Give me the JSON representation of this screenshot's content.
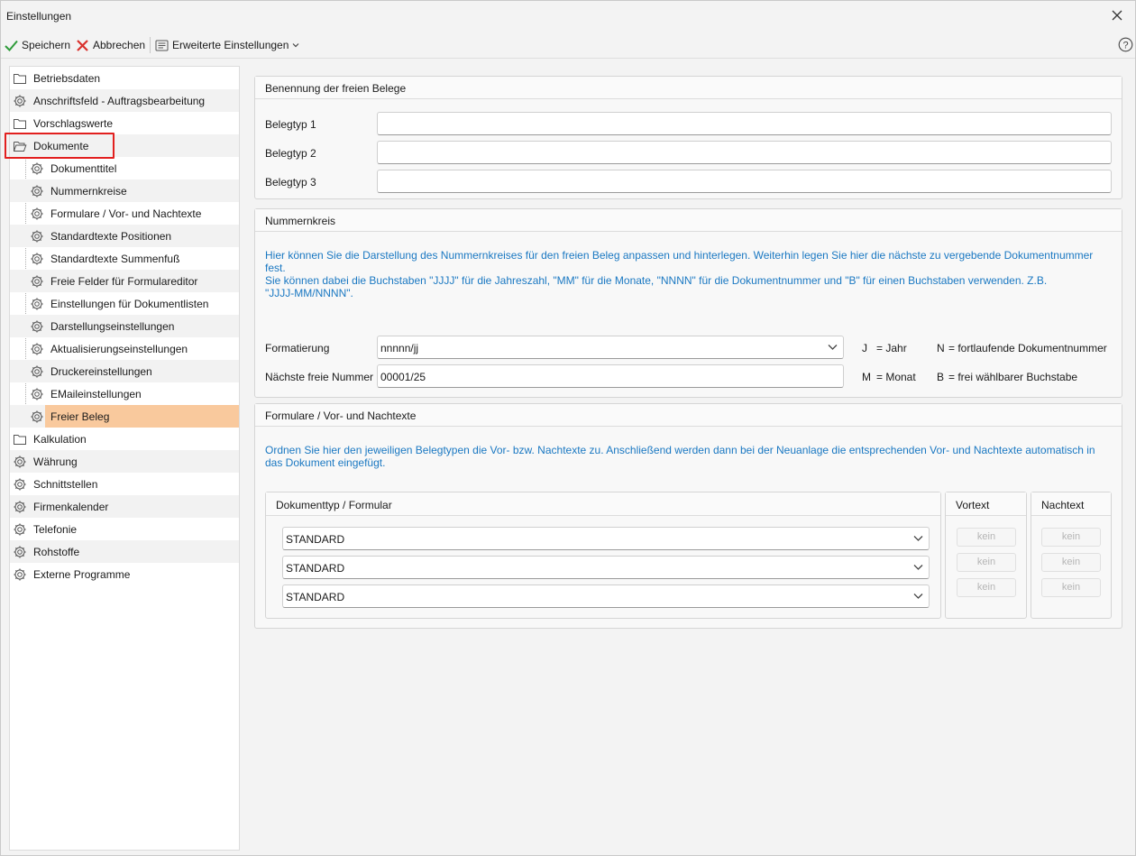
{
  "window": {
    "title": "Einstellungen"
  },
  "toolbar": {
    "save_label": "Speichern",
    "cancel_label": "Abbrechen",
    "advanced_label": "Erweiterte Einstellungen"
  },
  "tree": {
    "items": [
      {
        "label": "Betriebsdaten",
        "icon": "folder-icon"
      },
      {
        "label": "Anschriftsfeld - Auftragsbearbeitung",
        "icon": "gear-icon"
      },
      {
        "label": "Vorschlagswerte",
        "icon": "folder-icon"
      },
      {
        "label": "Dokumente",
        "icon": "folder-open-icon"
      },
      {
        "label": "Dokumenttitel",
        "icon": "gear-icon"
      },
      {
        "label": "Nummernkreise",
        "icon": "gear-icon"
      },
      {
        "label": "Formulare / Vor- und Nachtexte",
        "icon": "gear-icon"
      },
      {
        "label": "Standardtexte Positionen",
        "icon": "gear-icon"
      },
      {
        "label": "Standardtexte Summenfuß",
        "icon": "gear-icon"
      },
      {
        "label": "Freie Felder für Formulareditor",
        "icon": "gear-icon"
      },
      {
        "label": "Einstellungen für Dokumentlisten",
        "icon": "gear-icon"
      },
      {
        "label": "Darstellungseinstellungen",
        "icon": "gear-icon"
      },
      {
        "label": "Aktualisierungseinstellungen",
        "icon": "gear-icon"
      },
      {
        "label": "Druckereinstellungen",
        "icon": "gear-icon"
      },
      {
        "label": "EMaileinstellungen",
        "icon": "gear-icon"
      },
      {
        "label": "Freier Beleg",
        "icon": "gear-icon"
      },
      {
        "label": "Kalkulation",
        "icon": "folder-icon"
      },
      {
        "label": "Währung",
        "icon": "gear-icon"
      },
      {
        "label": "Schnittstellen",
        "icon": "gear-icon"
      },
      {
        "label": "Firmenkalender",
        "icon": "gear-icon"
      },
      {
        "label": "Telefonie",
        "icon": "gear-icon"
      },
      {
        "label": "Rohstoffe",
        "icon": "gear-icon"
      },
      {
        "label": "Externe Programme",
        "icon": "gear-icon"
      }
    ]
  },
  "benennung": {
    "title": "Benennung der freien Belege",
    "belegtyp1_label": "Belegtyp 1",
    "belegtyp1_value": "",
    "belegtyp2_label": "Belegtyp 2",
    "belegtyp2_value": "",
    "belegtyp3_label": "Belegtyp 3",
    "belegtyp3_value": ""
  },
  "nummernkreis": {
    "title": "Nummernkreis",
    "info1": "Hier können Sie die Darstellung des Nummernkreises für den freien Beleg anpassen und hinterlegen. Weiterhin legen Sie hier die nächste zu vergebende Dokumentnummer fest.",
    "info2": "Sie können dabei die Buchstaben \"JJJJ\" für die Jahreszahl, \"MM\" für die Monate, \"NNNN\" für die Dokumentnummer und \"B\" für einen Buchstaben verwenden. Z.B. \"JJJJ-MM/NNNN\".",
    "format_label": "Formatierung",
    "format_value": "nnnnn/jj",
    "next_label": "Nächste freie Nummer",
    "next_value": "00001/25",
    "legend_j": "J",
    "legend_j_text": "= Jahr",
    "legend_n": "N",
    "legend_n_text": "= fortlaufende Dokumentnummer",
    "legend_m": "M",
    "legend_m_text": "= Monat",
    "legend_b": "B",
    "legend_b_text": "= frei wählbarer Buchstabe"
  },
  "formulare": {
    "title": "Formulare / Vor- und Nachtexte",
    "info": "Ordnen Sie hier den jeweiligen Belegtypen die Vor- bzw. Nachtexte zu. Anschließend werden dann bei der Neuanlage die entsprechenden Vor- und Nachtexte automatisch in das Dokument eingefügt.",
    "col_doc": "Dokumenttyp / Formular",
    "col_vortext": "Vortext",
    "col_nachtext": "Nachtext",
    "rows": [
      {
        "form": "STANDARD",
        "vortext": "kein",
        "nachtext": "kein"
      },
      {
        "form": "STANDARD",
        "vortext": "kein",
        "nachtext": "kein"
      },
      {
        "form": "STANDARD",
        "vortext": "kein",
        "nachtext": "kein"
      }
    ]
  },
  "colors": {
    "accent_info": "#1a78c2",
    "selection": "#f9c99d",
    "highlight": "#e2201f",
    "save_green": "#2e9b3a",
    "cancel_red": "#d9302c"
  }
}
